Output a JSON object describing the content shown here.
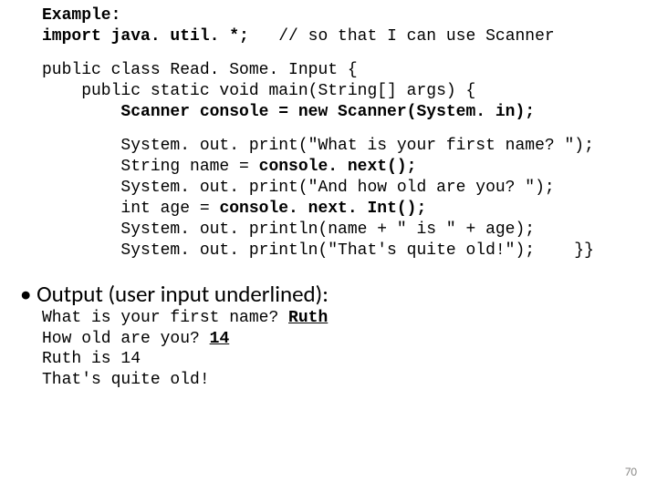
{
  "example_label": "Example:",
  "import_line_code": "import java. util. *;",
  "import_line_comment": "   // so that I can use Scanner",
  "class_line": "public class Read. Some. Input {",
  "main_line": "    public static void main(String[] args) {",
  "scanner_line": "        Scanner console = new Scanner(System. in);",
  "b1": "        System. out. print(\"What is your first name? \");",
  "b2a": "        String name = ",
  "b2b": "console. next();",
  "b3": "        System. out. print(\"And how old are you? \");",
  "b4a": "        int age = ",
  "b4b": "console. next. Int();",
  "b5": "        System. out. println(name + \" is \" + age);",
  "b6": "        System. out. println(\"That's quite old!\");    }}",
  "output_heading": "Output (user input underlined):",
  "out1a": "What is your first name? ",
  "out1b": "Ruth",
  "out2a": "How old are you? ",
  "out2b": "14",
  "out3": "Ruth is 14",
  "out4": "That's quite old!",
  "page_number": "70"
}
